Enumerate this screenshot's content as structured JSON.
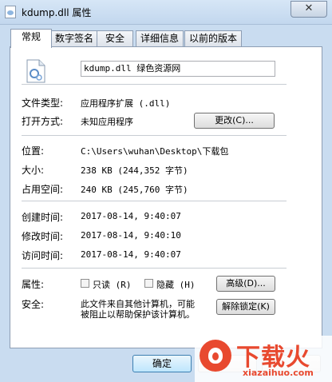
{
  "window": {
    "title": "kdump.dll 属性",
    "close_label": "✕"
  },
  "tabs": [
    "常规",
    "数字签名",
    "安全",
    "详细信息",
    "以前的版本"
  ],
  "general": {
    "file_name": "kdump.dll 绿色资源网",
    "type_label": "文件类型:",
    "type_value": "应用程序扩展 (.dll)",
    "open_label": "打开方式:",
    "open_value": "未知应用程序",
    "change_button": "更改(C)...",
    "location_label": "位置:",
    "location_value": "C:\\Users\\wuhan\\Desktop\\下载包",
    "size_label": "大小:",
    "size_value": "238 KB (244,352 字节)",
    "disk_label": "占用空间:",
    "disk_value": "240 KB (245,760 字节)",
    "created_label": "创建时间:",
    "created_value": "2017-08-14, 9:40:07",
    "modified_label": "修改时间:",
    "modified_value": "2017-08-14, 9:40:10",
    "accessed_label": "访问时间:",
    "accessed_value": "2017-08-14, 9:40:07",
    "attributes_label": "属性:",
    "readonly_label": "只读 (R)",
    "hidden_label": "隐藏 (H)",
    "advanced_button": "高级(D)...",
    "security_label": "安全:",
    "security_line1": "此文件来自其他计算机，可能",
    "security_line2": "被阻止以帮助保护该计算机。",
    "unblock_button": "解除锁定(K)"
  },
  "footer": {
    "ok_button": "确定"
  },
  "watermark": {
    "brand": "下载火",
    "url": "xiazaihuo.com"
  },
  "icons": [
    "dll-file-icon",
    "close-icon",
    "watermark-logo-icon"
  ]
}
